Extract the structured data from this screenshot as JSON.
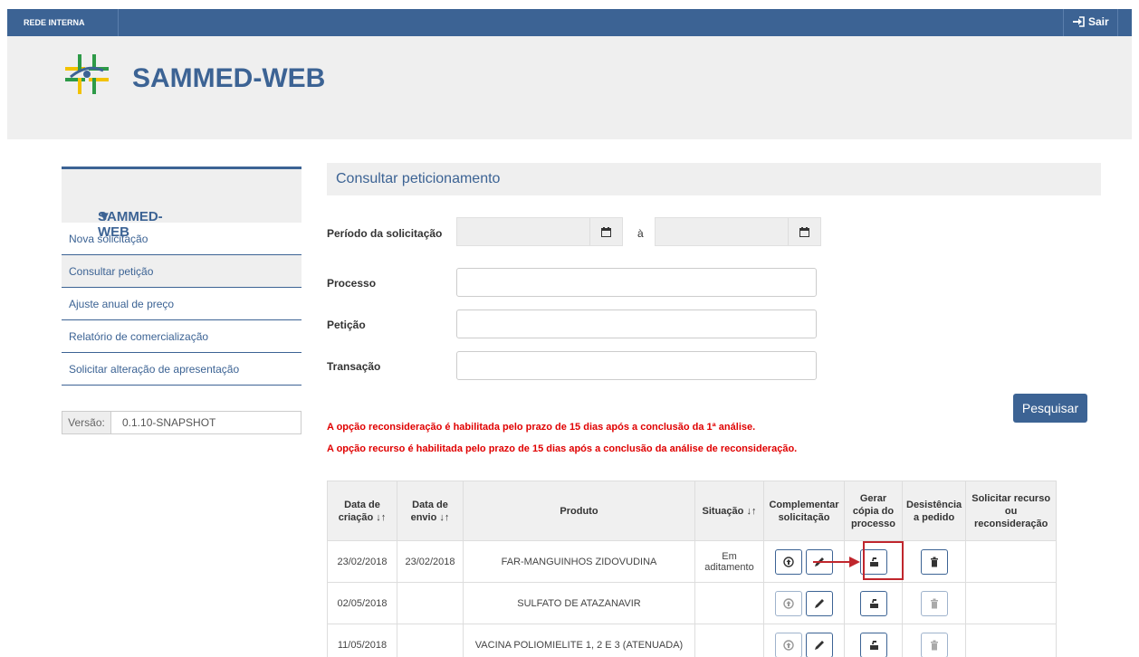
{
  "topbar": {
    "left_label": "REDE INTERNA",
    "logout_label": "Sair"
  },
  "header": {
    "brand": "SAMMED-WEB"
  },
  "sidebar": {
    "title": "SAMMED-WEB",
    "items": [
      {
        "label": "Nova solicitação"
      },
      {
        "label": "Consultar petição"
      },
      {
        "label": "Ajuste anual de preço"
      },
      {
        "label": "Relatório de comercialização"
      },
      {
        "label": "Solicitar alteração de apresentação"
      }
    ],
    "version_label": "Versão:",
    "version_value": "0.1.10-SNAPSHOT"
  },
  "main": {
    "title": "Consultar peticionamento",
    "form": {
      "period_label": "Período da solicitação",
      "period_sep": "à",
      "processo_label": "Processo",
      "peticao_label": "Petição",
      "transacao_label": "Transação",
      "search_label": "Pesquisar"
    },
    "notices": [
      "A opção reconsideração é habilitada pelo prazo de 15 dias após a conclusão da 1ª análise.",
      "A opção recurso é habilitada pelo prazo de 15 dias após a conclusão da análise de reconsideração."
    ],
    "table": {
      "headers": {
        "criacao": "Data de criação",
        "envio": "Data de envio",
        "produto": "Produto",
        "situacao": "Situação",
        "complementar": "Complementar solicitação",
        "gerar": "Gerar cópia do processo",
        "desistencia": "Desistência a pedido",
        "solicitar": "Solicitar recurso ou reconsideração"
      },
      "rows": [
        {
          "criacao": "23/02/2018",
          "envio": "23/02/2018",
          "produto": "FAR-MANGUINHOS ZIDOVUDINA",
          "situacao": "Em aditamento"
        },
        {
          "criacao": "02/05/2018",
          "envio": "",
          "produto": "SULFATO DE ATAZANAVIR",
          "situacao": ""
        },
        {
          "criacao": "11/05/2018",
          "envio": "",
          "produto": "VACINA POLIOMIELITE 1, 2 E 3 (ATENUADA)",
          "situacao": ""
        }
      ]
    }
  },
  "colors": {
    "primary": "#3c6394",
    "notice": "#e00000",
    "highlight": "#c0262d"
  }
}
